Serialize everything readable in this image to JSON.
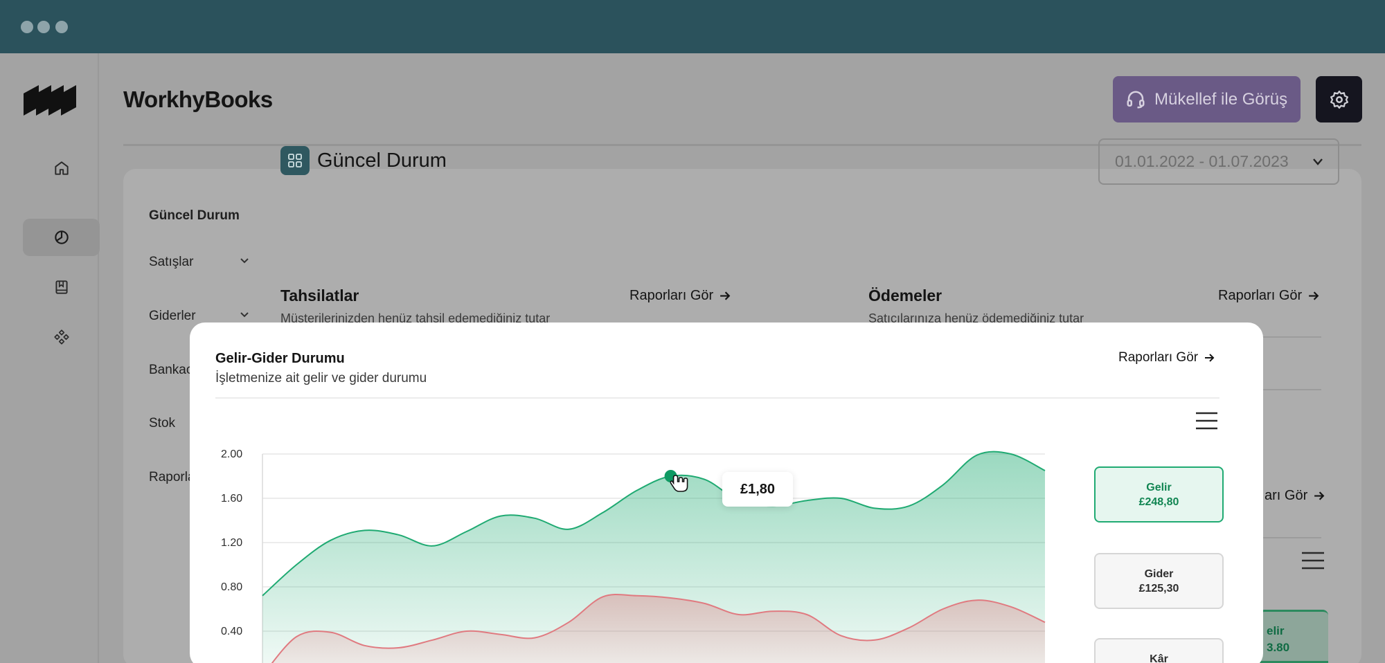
{
  "app": {
    "name": "WorkhyBooks"
  },
  "header": {
    "meet_label": "Mükellef ile Görüş"
  },
  "subnav": {
    "items": [
      {
        "label": "Güncel Durum"
      },
      {
        "label": "Satışlar"
      },
      {
        "label": "Giderler"
      },
      {
        "label": "Bankac"
      },
      {
        "label": "Stok"
      },
      {
        "label": "Raporla"
      }
    ]
  },
  "section": {
    "title": "Güncel Durum",
    "date_range": "01.01.2022 - 01.07.2023"
  },
  "cards": {
    "tahsilatlar": {
      "title": "Tahsilatlar",
      "subtitle": "Müşterilerinizden henüz tahsil edemediğiniz tutar",
      "link": "Raporları Gör"
    },
    "odemeler": {
      "title": "Ödemeler",
      "subtitle": "Satıcılarınıza henüz ödemediğiniz tutar",
      "link": "Raporları Gör"
    },
    "background_link": "arı Gör",
    "background_chip": {
      "label": "elir",
      "value": "3.80"
    }
  },
  "modal": {
    "title": "Gelir-Gider Durumu",
    "subtitle": "İşletmenize ait gelir ve gider durumu",
    "link": "Raporları Gör",
    "tooltip": "£1,80",
    "legend": [
      {
        "label": "Gelir",
        "value": "£248,80",
        "color": "#1faa72"
      },
      {
        "label": "Gider",
        "value": "£125,30",
        "color": "#e07a80"
      },
      {
        "label": "Kâr",
        "value": ""
      }
    ]
  },
  "chart_data": {
    "type": "area",
    "ylim": [
      0,
      2.0
    ],
    "yticks": [
      "2.00",
      "1.60",
      "1.20",
      "0.80",
      "0.40"
    ],
    "series": [
      {
        "name": "Gelir",
        "color": "#1faa72",
        "values": [
          0.72,
          1.0,
          1.22,
          1.31,
          1.27,
          1.17,
          1.3,
          1.44,
          1.42,
          1.32,
          1.47,
          1.67,
          1.8,
          1.77,
          1.58,
          1.53,
          1.58,
          1.6,
          1.51,
          1.53,
          1.72,
          1.99,
          2.0,
          1.85
        ]
      },
      {
        "name": "Gider",
        "color": "#e07a80",
        "values": [
          0.0,
          0.35,
          0.39,
          0.27,
          0.25,
          0.32,
          0.4,
          0.37,
          0.34,
          0.48,
          0.71,
          0.72,
          0.7,
          0.65,
          0.55,
          0.58,
          0.55,
          0.36,
          0.32,
          0.43,
          0.6,
          0.68,
          0.62,
          0.48
        ]
      }
    ]
  }
}
